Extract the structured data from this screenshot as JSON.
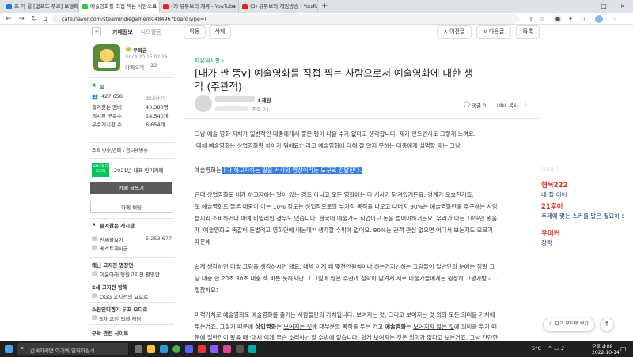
{
  "browser": {
    "tabs": [
      {
        "label": "프 커 윌 [없프드 푸르] 보일확장",
        "color": "#1a73e8"
      },
      {
        "label": "예술영화를 직접 찍는 사람으로",
        "color": "#2ecc40"
      },
      {
        "label": "(7) 유튜브의 계류 - YouTube",
        "color": "#e62117"
      },
      {
        "label": "(3) 유튜브의 게임방송 - YouTub",
        "color": "#e62117"
      }
    ],
    "new_tab": "+",
    "url": "cafe.naver.com/steamindiegame/8048496?boardType=l"
  },
  "sidebar": {
    "tab_cafe_info": "카페정보",
    "tab_my_activity": "나의활동",
    "manager_name": "우왁굳",
    "since": "since 20 15.02.26.",
    "cafe_intro": "카페소개",
    "member_count_label": "22",
    "rank_label": "숲",
    "stat1_value": "427,658",
    "stat1_label": "초대하기",
    "stat2_label": "즐겨찾는 멤버",
    "stat2_value": "43,383명",
    "stat3_label": "게시판 구독수",
    "stat3_value": "14,540개",
    "stat4_label": "우수게시판 수",
    "stat4_value": "6,654개",
    "tags": "주제 방송/연예 › 인터넷방송",
    "award_badge": "NAVER 대표카페",
    "award_text": "2021년 대표 인기카페",
    "write_button": "카페 글쓰기",
    "chat_button": "카페 채팅",
    "fav_boards": "즐겨찾는 게시판",
    "all_posts": "전체글보기",
    "all_posts_count": "5,253,677",
    "best_posts": "베스트게시글",
    "section1": "왜닌 고지전 명장면",
    "s1_item": "이윤아래 행원고지전 활명합",
    "section2": "2세 고지전 방해",
    "s2_item": "OGG 교지전의 요요로",
    "section3": "스팀인디겜기 두꼬 오디로",
    "s3_item": "5차 교전 업데 게임",
    "section4": "우왁 관련 사이트"
  },
  "toolbar": {
    "edit": "이동",
    "delete": "삭제",
    "prev": "∧ 이전글",
    "next": "∨ 다음글",
    "list": "목록"
  },
  "article": {
    "board": "자유게시판 ›",
    "title_line1": "[내가 싼 똥v] 예술영화를 직접 찍는 사람으로서 예술영화에 대한 생",
    "title_line2": "각 (주관적)",
    "author": "I 재탐",
    "views": "조회 21",
    "comments": "댓글 0",
    "url_copy": "URL 복사",
    "p1_l1": "그냥 예술 영화 자체가 일반적인 대중에게서 좋은 평이 나올 수가 없다고 생각합니다. 제가 만드면서도 그렇게 느껴요.",
    "p1_l2": "'대체 예술영화는 상업영화랑 차이가 뭐에요?' 라고 예술영화에 대해 잘 알지 못하는 대중에게 설명할 때는 그냥",
    "p2_plain": "예술영화는",
    "p2_highlight": "내가 하고자하는 말을 서사와 영상이라는 도구로 전달한다.",
    "p3_l1": "근데 상업영화도 내가 하고자하는 말이 있는 경도 아니고 모든 영화에는 다 서사가 담겨있거든요. 경계가 모호한거죠.",
    "p3_l2": "또 예술영화도 물론 대중이 이는 10% 정도는 상업적으로의 부가적 목적을 나오고 나머지 90%는 예술영화만을 추구하는 사람",
    "p3_l3": "들끼리 소비하거나 아예 비영리인 경우도 있습니다. 결국에 예술가도 직업이고 돈을 벌어야하거든요. 우리가 아는 10%만 봤을",
    "p3_l4": "때 '예술영화도 똑같이 돈벌려고 영화만에 내는데?' 생각할 수밖에 없어요. 90%는 관객 관심 없으면 어디서 보는지도 모르기",
    "p3_l5": "때문에",
    "p4_l1": "쉽게 생각하면 미술 그림을 생각하시면 돼요. 대체 이게 왜 몇천만원씩이나 하는거지? 하는 그림들이 일반인의 눈에는 정말 그",
    "p4_l2": "냥 대충 한 20초 30초 대충 색 바른 듯하지만 그 그림에 많은 주관과 철학이 담겨서 서로 미술가들에게는 원정히 고평가받고 그",
    "p4_l3": "렇잖아요?",
    "p5_l1": "미적가치로 예술영화도 예술영화를 즐기는 사람들만의 가치입니다. 보여지는 것, 그리고 보여지는 것 외의 모든 의미을 가치에",
    "p5_l2a": "두는거죠. 그렇기 때문에 ",
    "p5_l2b": "상업영화",
    "p5_l2c": "는 ",
    "p5_l2d": "보여지는 것",
    "p5_l2e": "에 대부분의 목적을 두는 거고 ",
    "p5_l2f": "예술영화",
    "p5_l2g": "는 ",
    "p5_l2h": "보여지지 않는 것",
    "p5_l2i": "에 의미를 두기 때",
    "p5_l3": "문에 일반인이 봤을 때 '대체 이게 무슨 소리야?' 할 수밖에 없습니다. 쉽게 보여지는 것은 의미가 없다고 보는거죠. 그냥 간단한"
  },
  "overlay": {
    "blur_line": "lllllllll",
    "user1": "형욱222",
    "user1_text": "내 질 이어",
    "user2": "21후이",
    "user2_text": "주제에 맞는 스커를 말은 필요하 s",
    "user3": "우미커",
    "user3_text": "장락",
    "dark_mode": "다크 모드로 보기",
    "to_top": "↑"
  },
  "taskbar": {
    "search_placeholder": "검색하려면 여기에 입력하십시",
    "weather": "5°C",
    "time": "오후 4:08",
    "date": "2022-10-14"
  },
  "colors": {
    "highlight": "#3a7ee0",
    "naver_green": "#03c75a",
    "overlay_red": "#e0301e",
    "overlay_navy": "#1e3a6e"
  }
}
